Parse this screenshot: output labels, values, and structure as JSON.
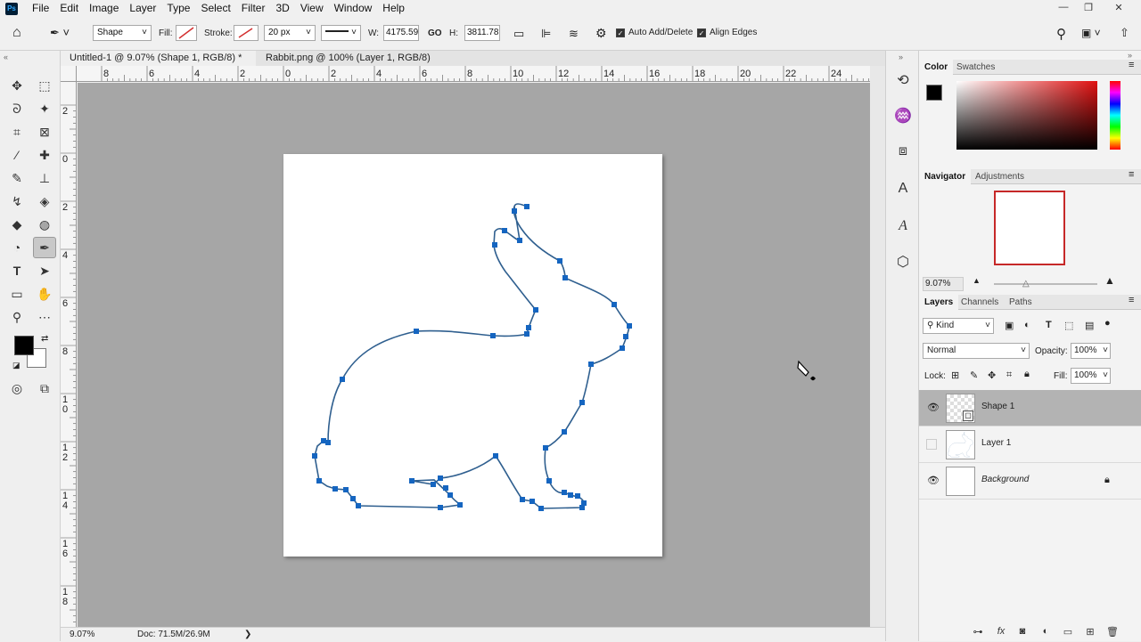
{
  "app": {
    "logo": "Ps"
  },
  "menu": [
    "File",
    "Edit",
    "Image",
    "Layer",
    "Type",
    "Select",
    "Filter",
    "3D",
    "View",
    "Window",
    "Help"
  ],
  "window_controls": {
    "minimize": "—",
    "restore": "❐",
    "close": "✕"
  },
  "options": {
    "mode": "Shape",
    "fill_label": "Fill:",
    "stroke_label": "Stroke:",
    "stroke_size": "20 px",
    "w_label": "W:",
    "w_value": "4175.59",
    "link": "GO",
    "h_label": "H:",
    "h_value": "3811.78",
    "auto_add_delete": "Auto Add/Delete",
    "align_edges": "Align Edges"
  },
  "tabs": [
    {
      "label": "Untitled-1 @ 9.07% (Shape 1, RGB/8) *",
      "close": "×"
    },
    {
      "label": "Rabbit.png @ 100% (Layer 1, RGB/8)",
      "close": "×"
    }
  ],
  "ruler": {
    "h": [
      "8",
      "6",
      "4",
      "2",
      "0",
      "2",
      "4",
      "6",
      "8",
      "10",
      "12",
      "14",
      "16",
      "18",
      "20",
      "22",
      "24"
    ],
    "v": [
      "2",
      "0",
      "2",
      "4",
      "6",
      "8",
      "1\n0",
      "1\n2",
      "1\n4",
      "1\n6",
      "1\n8"
    ]
  },
  "status": {
    "zoom": "9.07%",
    "doc": "Doc: 71.5M/26.9M",
    "arrow": "❯"
  },
  "color_panel": {
    "tabs": [
      "Color",
      "Swatches"
    ],
    "foreground": "#000000",
    "background": "#ffffff"
  },
  "navigator": {
    "tabs": [
      "Navigator",
      "Adjustments"
    ],
    "zoom": "9.07%"
  },
  "layers_panel": {
    "tabs": [
      "Layers",
      "Channels",
      "Paths"
    ],
    "kind": "Kind",
    "blend_mode": "Normal",
    "opacity_label": "Opacity:",
    "opacity": "100%",
    "lock_label": "Lock:",
    "fill_label": "Fill:",
    "fill": "100%",
    "layers": [
      {
        "name": "Shape 1",
        "visible": true,
        "selected": true
      },
      {
        "name": "Layer 1",
        "visible": false,
        "selected": false
      },
      {
        "name": "Background",
        "visible": true,
        "selected": false,
        "locked": true
      }
    ],
    "footer_icons": [
      "link-icon",
      "fx-icon",
      "mask-icon",
      "adjustment-icon",
      "group-icon",
      "new-layer-icon",
      "trash-icon"
    ]
  },
  "colors": {
    "accent": "#1565c0",
    "path": "#2f5f8f",
    "workspace": "#a6a6a6"
  }
}
